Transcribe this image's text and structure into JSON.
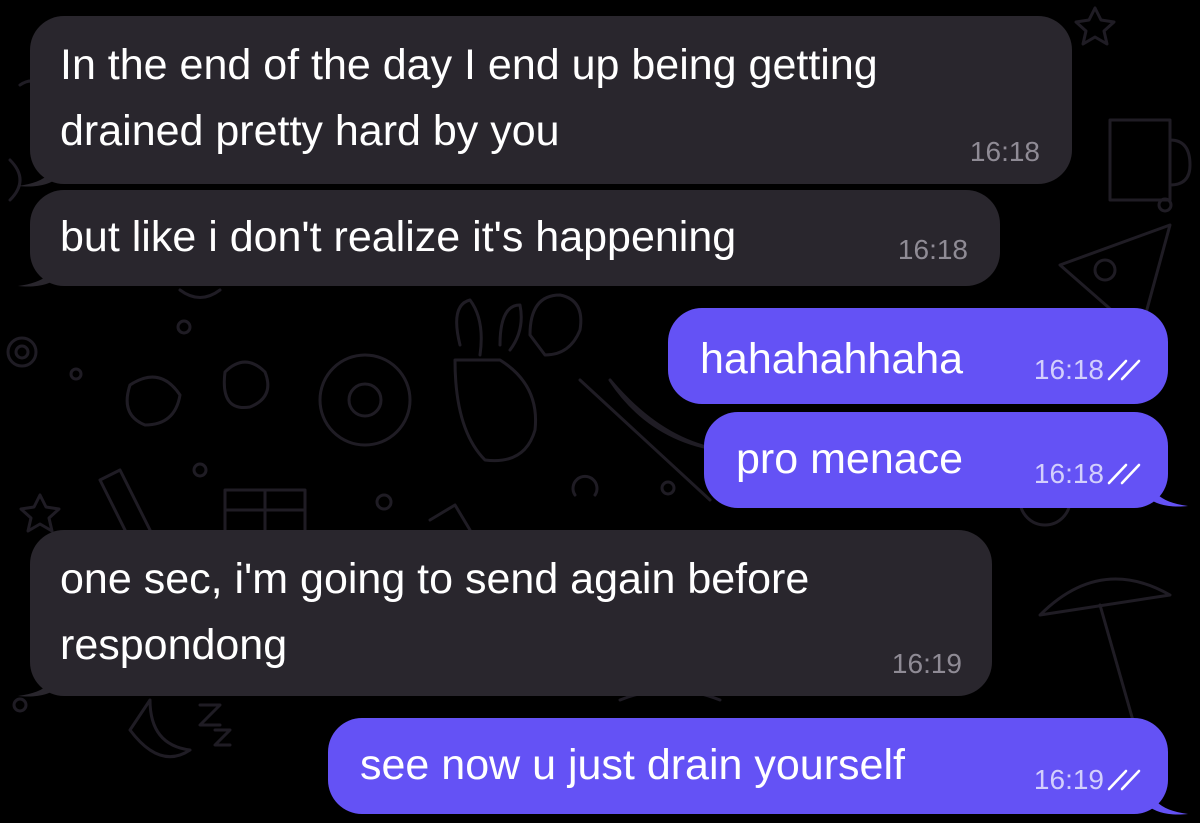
{
  "chat": {
    "background_color": "#000000",
    "incoming_bubble_color": "#29262d",
    "outgoing_bubble_color": "#6452f5",
    "messages": [
      {
        "direction": "incoming",
        "lines": [
          "In the end of the day I end up being getting",
          "drained pretty hard by you"
        ],
        "time": "16:18"
      },
      {
        "direction": "incoming",
        "lines": [
          "but like i don't realize it's happening"
        ],
        "time": "16:18"
      },
      {
        "direction": "outgoing",
        "lines": [
          "hahahahhaha"
        ],
        "time": "16:18",
        "status": "read-double-check-icon"
      },
      {
        "direction": "outgoing",
        "lines": [
          "pro menace"
        ],
        "time": "16:18",
        "status": "read-double-check-icon"
      },
      {
        "direction": "incoming",
        "lines": [
          "one sec, i'm going to send again before",
          "respondong"
        ],
        "time": "16:19"
      },
      {
        "direction": "outgoing",
        "lines": [
          "see now u just drain yourself"
        ],
        "time": "16:19",
        "status": "read-double-check-icon"
      }
    ]
  }
}
